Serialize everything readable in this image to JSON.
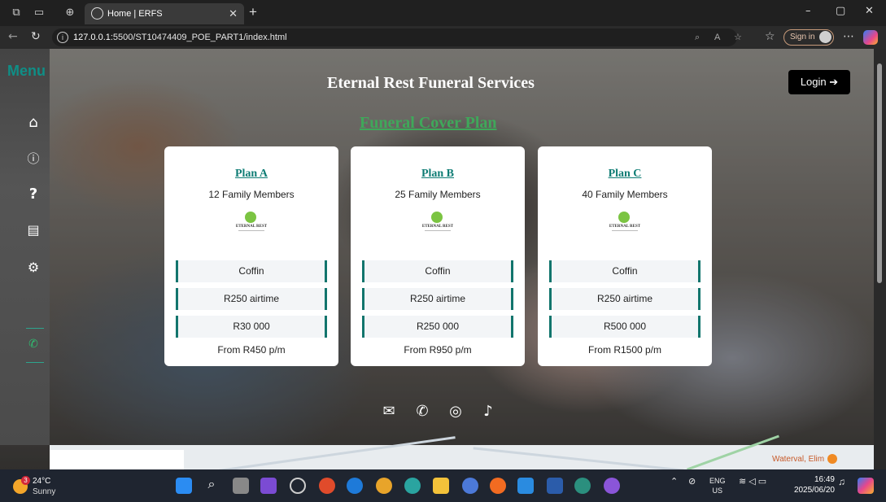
{
  "browser": {
    "tab_title": "Home | ERFS",
    "url_host": "127.0.0.1",
    "url_path": ":5500/ST10474409_POE_PART1/index.html",
    "sign_in_label": "Sign in"
  },
  "sidebar": {
    "title": "Menu",
    "items": [
      "home-icon",
      "info-icon",
      "question-icon",
      "contact-card-icon",
      "settings-icon",
      "whatsapp-icon"
    ]
  },
  "header": {
    "site_title": "Eternal Rest Funeral Services",
    "login_label": "Login"
  },
  "section": {
    "title": "Funeral Cover Plan"
  },
  "plans": [
    {
      "name": "Plan A",
      "members": "12 Family Members",
      "logo_text": "ETERNAL REST",
      "features": [
        "Coffin",
        "R250 airtime",
        "R30 000"
      ],
      "price": "From R450 p/m"
    },
    {
      "name": "Plan B",
      "members": "25 Family Members",
      "logo_text": "ETERNAL REST",
      "features": [
        "Coffin",
        "R250 airtime",
        "R250 000"
      ],
      "price": "From R950 p/m"
    },
    {
      "name": "Plan C",
      "members": "40 Family Members",
      "logo_text": "ETERNAL REST",
      "features": [
        "Coffin",
        "R250 airtime",
        "R500 000"
      ],
      "price": "From R1500 p/m"
    }
  ],
  "footer": {
    "social": [
      "email-icon",
      "whatsapp-icon",
      "instagram-icon",
      "tiktok-icon"
    ]
  },
  "map": {
    "place_label": "Waterval, Elim"
  },
  "taskbar": {
    "weather_temp": "24°C",
    "weather_cond": "Sunny",
    "weather_badge": "3",
    "lang_top": "ENG",
    "lang_bottom": "US",
    "time": "16:49",
    "date": "2025/06/20"
  },
  "colors": {
    "accent": "#0e7c74",
    "menu": "#0f8e86",
    "subtitle": "#3fa85a"
  }
}
